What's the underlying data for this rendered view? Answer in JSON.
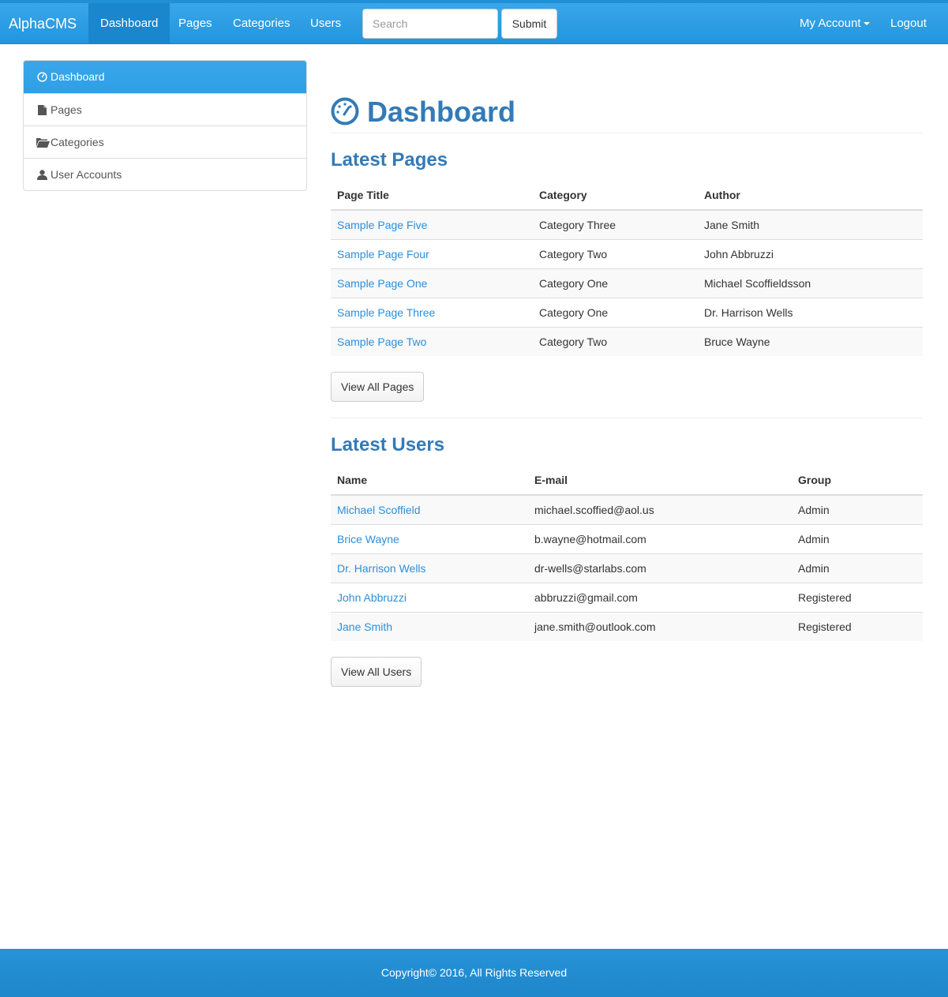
{
  "navbar": {
    "brand": "AlphaCMS",
    "items": [
      {
        "label": "Dashboard",
        "active": true
      },
      {
        "label": "Pages"
      },
      {
        "label": "Categories"
      },
      {
        "label": "Users"
      }
    ],
    "search_placeholder": "Search",
    "submit_label": "Submit",
    "account_label": "My Account",
    "logout_label": "Logout"
  },
  "sidebar": {
    "items": [
      {
        "label": "Dashboard",
        "icon": "dashboard-icon",
        "active": true
      },
      {
        "label": "Pages",
        "icon": "file-icon"
      },
      {
        "label": "Categories",
        "icon": "folder-open-icon"
      },
      {
        "label": "User Accounts",
        "icon": "user-icon"
      }
    ]
  },
  "main": {
    "title": "Dashboard",
    "latest_pages": {
      "heading": "Latest Pages",
      "columns": [
        "Page Title",
        "Category",
        "Author"
      ],
      "rows": [
        [
          "Sample Page Five",
          "Category Three",
          "Jane Smith"
        ],
        [
          "Sample Page Four",
          "Category Two",
          "John Abbruzzi"
        ],
        [
          "Sample Page One",
          "Category One",
          "Michael Scoffieldsson"
        ],
        [
          "Sample Page Three",
          "Category One",
          "Dr. Harrison Wells"
        ],
        [
          "Sample Page Two",
          "Category Two",
          "Bruce Wayne"
        ]
      ],
      "button_label": "View All Pages"
    },
    "latest_users": {
      "heading": "Latest Users",
      "columns": [
        "Name",
        "E-mail",
        "Group"
      ],
      "rows": [
        [
          "Michael Scoffield",
          "michael.scoffied@aol.us",
          "Admin"
        ],
        [
          "Brice Wayne",
          "b.wayne@hotmail.com",
          "Admin"
        ],
        [
          "Dr. Harrison Wells",
          "dr-wells@starlabs.com",
          "Admin"
        ],
        [
          "John Abbruzzi",
          "abbruzzi@gmail.com",
          "Registered"
        ],
        [
          "Jane Smith",
          "jane.smith@outlook.com",
          "Registered"
        ]
      ],
      "button_label": "View All Users"
    }
  },
  "footer": {
    "text": "Copyright© 2016, All Rights Reserved"
  },
  "colors": {
    "primary": "#2e9fe6",
    "link": "#2a8fdd",
    "heading": "#337ab7"
  }
}
